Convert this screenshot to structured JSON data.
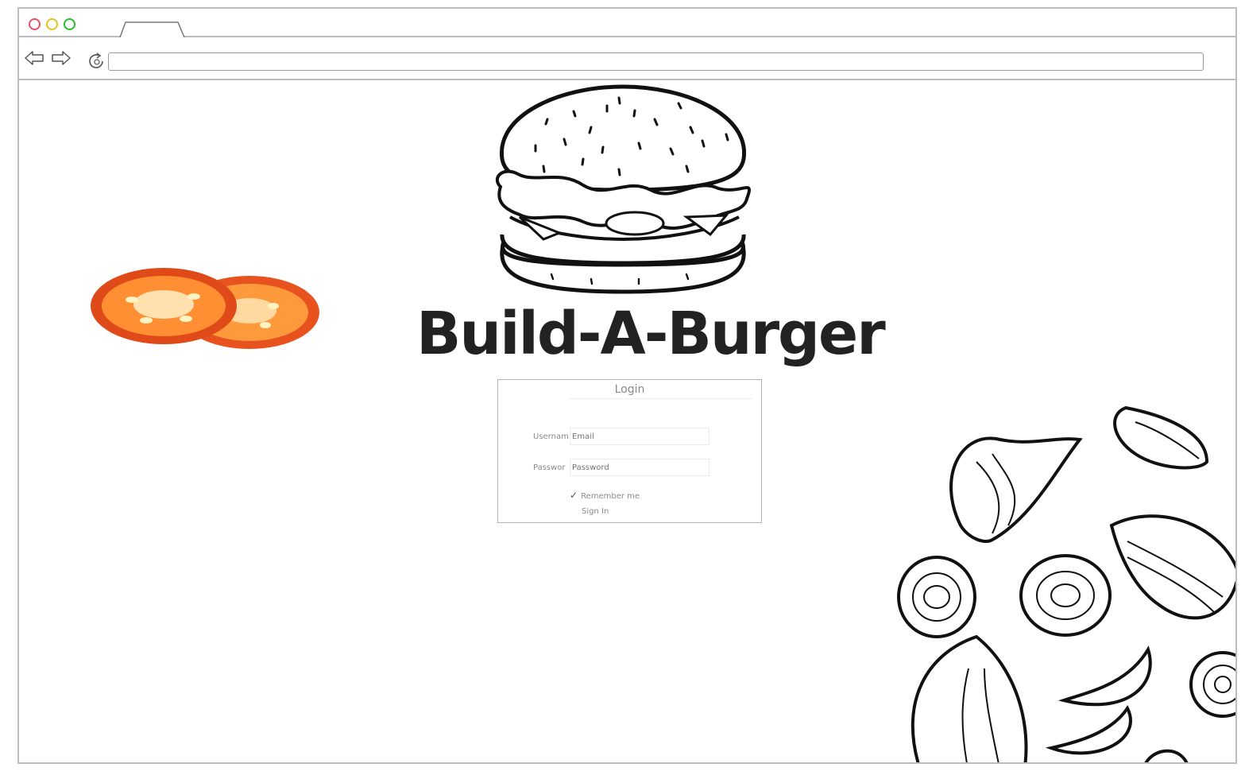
{
  "page": {
    "title": "Build-A-Burger"
  },
  "login": {
    "title": "Login",
    "username_label": "Usernam",
    "username_placeholder": "Email",
    "password_label": "Passwor",
    "password_placeholder": "Password",
    "remember_label": "Remember me",
    "signin_label": "Sign In"
  },
  "icons": {
    "back": "back-arrow-icon",
    "forward": "forward-arrow-icon",
    "reload": "reload-icon"
  },
  "colors": {
    "window_close": "#e8506a",
    "window_minimize": "#e8c21c",
    "window_maximize": "#26c026",
    "tomato": "#f06a2a"
  }
}
